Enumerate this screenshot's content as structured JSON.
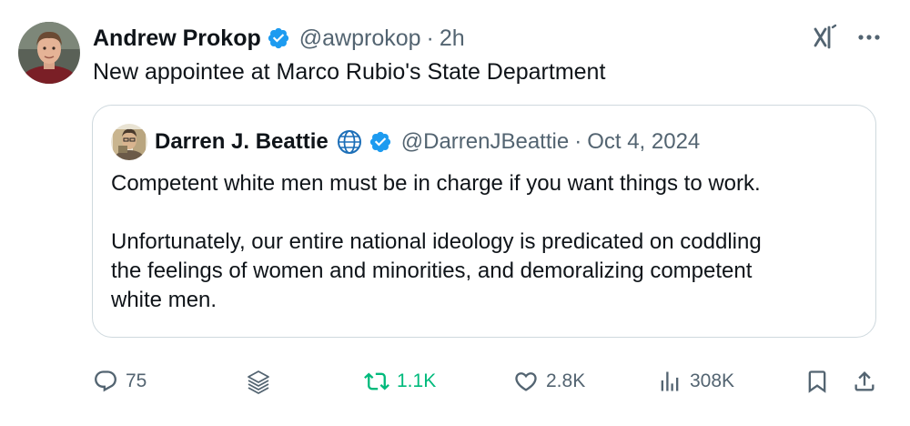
{
  "tweet": {
    "author": {
      "name": "Andrew Prokop",
      "handle": "@awprokop",
      "separator": "·",
      "time": "2h",
      "avatar_icon": "profile-photo"
    },
    "text": "New appointee at Marco Rubio's State Department",
    "top_icons": [
      "grok-icon",
      "more-icon"
    ]
  },
  "quote": {
    "author": {
      "name": "Darren J. Beattie",
      "handle": "@DarrenJBeattie",
      "separator": "·",
      "date": "Oct 4, 2024",
      "avatar_icon": "illustrated-avatar"
    },
    "paragraphs": [
      [
        "Competent white men must be in charge if you want things to work."
      ],
      [
        "Unfortunately, our entire national ideology is predicated on coddling",
        "the feelings of women and minorities, and demoralizing competent",
        "white men."
      ]
    ]
  },
  "actions": {
    "replies": "75",
    "reposts": "1.1K",
    "likes": "2.8K",
    "views": "308K"
  },
  "colors": {
    "verified": "#1d9bf0",
    "repost_active": "#00ba7c",
    "secondary_text": "#536471",
    "border": "#cfd9de"
  }
}
